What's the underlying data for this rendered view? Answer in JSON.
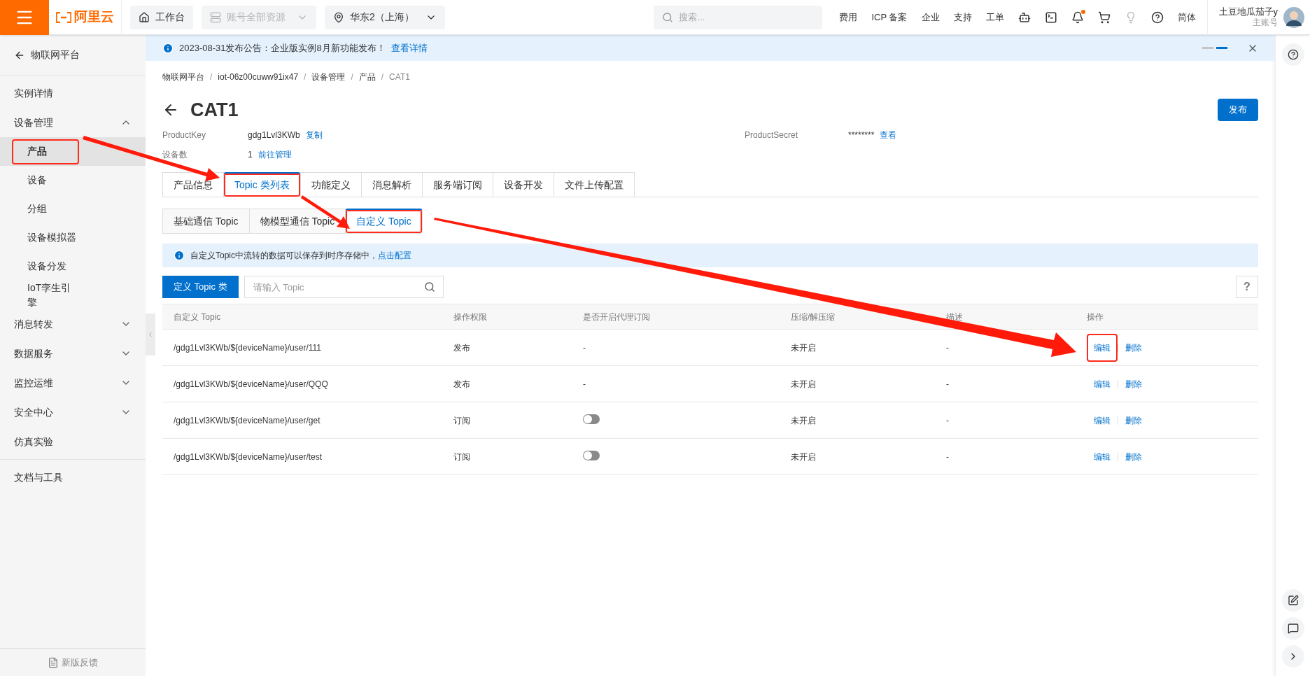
{
  "topbar": {
    "logo": "阿里云",
    "nav": [
      {
        "label": "工作台",
        "kind": "home",
        "disabled": false
      },
      {
        "label": "账号全部资源",
        "kind": "resources",
        "disabled": true
      },
      {
        "label": "华东2（上海）",
        "kind": "region",
        "disabled": false
      }
    ],
    "search": {
      "placeholder": "搜索..."
    },
    "links": [
      "费用",
      "ICP 备案",
      "企业",
      "支持",
      "工单"
    ],
    "language": "简体",
    "user": {
      "name": "土豆地瓜茄子y",
      "role": "主账号"
    },
    "notification_dot": true
  },
  "sidebar": {
    "back": "物联网平台",
    "items": [
      {
        "label": "实例详情"
      },
      {
        "label": "设备管理",
        "expanded": true,
        "children": [
          {
            "label": "产品",
            "selected": true,
            "annotated": true
          },
          {
            "label": "设备",
            "selected": false,
            "annotated": false
          },
          {
            "label": "分组",
            "selected": false,
            "annotated": false
          },
          {
            "label": "设备模拟器",
            "selected": false,
            "annotated": false
          },
          {
            "label": "设备分发",
            "selected": false,
            "annotated": false
          },
          {
            "label": "IoT孪生引擎",
            "selected": false,
            "annotated": false
          }
        ]
      },
      {
        "label": "消息转发",
        "expanded": false
      },
      {
        "label": "数据服务",
        "expanded": false
      },
      {
        "label": "监控运维",
        "expanded": false
      },
      {
        "label": "安全中心",
        "expanded": false
      },
      {
        "label": "仿真实验"
      }
    ],
    "footer_items": [
      "文档与工具"
    ],
    "feedback": "新版反馈"
  },
  "notice": {
    "text": "2023-08-31发布公告：企业版实例8月新功能发布！",
    "link": "查看详情"
  },
  "breadcrumb": [
    "物联网平台",
    "iot-06z00cuww91ix47",
    "设备管理",
    "产品",
    "CAT1"
  ],
  "breadcrumb_separator": "/",
  "title": "CAT1",
  "publish_button": "发布",
  "info": [
    {
      "label": "ProductKey",
      "value": "gdg1Lvl3KWb",
      "link": "复制"
    },
    {
      "label": "ProductSecret",
      "value": "********",
      "link": "查看"
    },
    {
      "label": "设备数",
      "value": "1",
      "link": "前往管理"
    }
  ],
  "tabs": [
    {
      "label": "产品信息",
      "selected": false,
      "annotated": false
    },
    {
      "label": "Topic 类列表",
      "selected": true,
      "annotated": true
    },
    {
      "label": "功能定义",
      "selected": false,
      "annotated": false
    },
    {
      "label": "消息解析",
      "selected": false,
      "annotated": false
    },
    {
      "label": "服务端订阅",
      "selected": false,
      "annotated": false
    },
    {
      "label": "设备开发",
      "selected": false,
      "annotated": false
    },
    {
      "label": "文件上传配置",
      "selected": false,
      "annotated": false
    }
  ],
  "subtabs": [
    {
      "label": "基础通信 Topic",
      "selected": false,
      "annotated": false
    },
    {
      "label": "物模型通信 Topic",
      "selected": false,
      "annotated": false
    },
    {
      "label": "自定义 Topic",
      "selected": true,
      "annotated": true
    }
  ],
  "tip": {
    "text": "自定义Topic中流转的数据可以保存到时序存储中，",
    "link": "点击配置"
  },
  "define_button": "定义 Topic 类",
  "topic_search": {
    "placeholder": "请输入 Topic"
  },
  "help_button": "?",
  "table": {
    "columns": [
      "自定义 Topic",
      "操作权限",
      "是否开启代理订阅",
      "压缩/解压缩",
      "描述",
      "操作"
    ],
    "rows": [
      {
        "topic": "/gdg1Lvl3KWb/${deviceName}/user/111",
        "permission": "发布",
        "proxy": {
          "kind": "text",
          "text": "-"
        },
        "compression": "未开启",
        "description": "-",
        "actions": [
          {
            "label": "编辑",
            "annotated": true
          },
          {
            "label": "删除",
            "annotated": false
          }
        ]
      },
      {
        "topic": "/gdg1Lvl3KWb/${deviceName}/user/QQQ",
        "permission": "发布",
        "proxy": {
          "kind": "text",
          "text": "-"
        },
        "compression": "未开启",
        "description": "-",
        "actions": [
          {
            "label": "编辑",
            "annotated": false
          },
          {
            "label": "删除",
            "annotated": false
          }
        ]
      },
      {
        "topic": "/gdg1Lvl3KWb/${deviceName}/user/get",
        "permission": "订阅",
        "proxy": {
          "kind": "switch",
          "on": false
        },
        "compression": "未开启",
        "description": "-",
        "actions": [
          {
            "label": "编辑",
            "annotated": false
          },
          {
            "label": "删除",
            "annotated": false
          }
        ]
      },
      {
        "topic": "/gdg1Lvl3KWb/${deviceName}/user/test",
        "permission": "订阅",
        "proxy": {
          "kind": "switch",
          "on": false
        },
        "compression": "未开启",
        "description": "-",
        "actions": [
          {
            "label": "编辑",
            "annotated": false
          },
          {
            "label": "删除",
            "annotated": false
          }
        ]
      }
    ]
  }
}
